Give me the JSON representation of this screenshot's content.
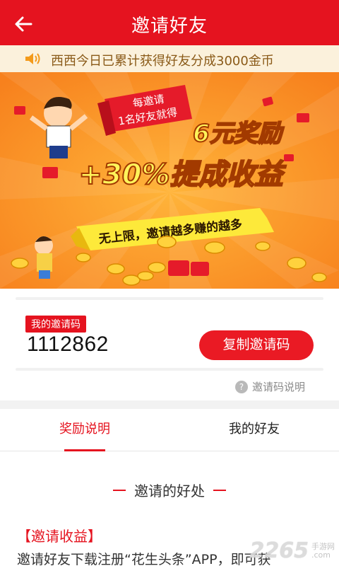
{
  "header": {
    "title": "邀请好友"
  },
  "notice": {
    "text": "西西今日已累计获得好友分成3000金币"
  },
  "banner": {
    "tag_line1": "每邀请",
    "tag_line2": "1名好友就得",
    "headline1": "6元奖励",
    "headline2": "+30%提成收益",
    "ribbon": "无上限，邀请越多赚的越多"
  },
  "invite": {
    "tag_label": "我的邀请码",
    "code": "1112862",
    "copy_label": "复制邀请码",
    "help_label": "邀请码说明"
  },
  "tabs": [
    {
      "label": "奖励说明",
      "active": true
    },
    {
      "label": "我的好友",
      "active": false
    }
  ],
  "section": {
    "title": "邀请的好处",
    "earn_title": "【邀请收益】",
    "earn_text": "邀请好友下载注册“花生头条”APP，即可获"
  },
  "watermark": {
    "number": "2265",
    "side_top": "手游网",
    "side_bottom": ".com"
  },
  "colors": {
    "brand_red": "#e5131f",
    "banner_orange": "#f7931e",
    "notice_bg": "#fbf1dc"
  }
}
